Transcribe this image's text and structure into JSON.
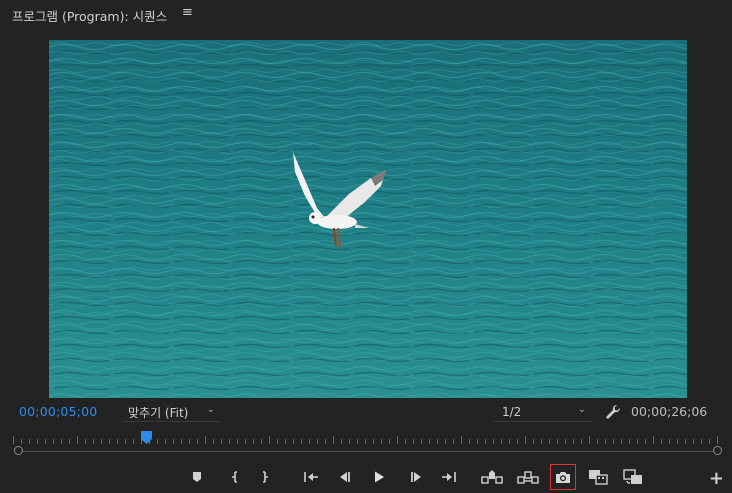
{
  "panel": {
    "title": "프로그램 (Program): 시퀀스",
    "menu_icon": "hamburger-menu-icon"
  },
  "viewer": {
    "content": "video-frame",
    "colors": {
      "water": "#1f7a82",
      "water_dark": "#165f66",
      "water_light": "#3fa1a4"
    }
  },
  "controls": {
    "current_timecode": "00;00;05;00",
    "zoom": {
      "label": "맞추기 (Fit)",
      "icon": "chevron-down-icon"
    },
    "resolution": {
      "label": "1/2",
      "icon": "chevron-down-icon"
    },
    "settings_icon": "wrench-icon",
    "duration_timecode": "00;00;26;06",
    "accent_color": "#2d8ceb"
  },
  "transport": {
    "buttons": [
      {
        "name": "add-marker-button",
        "icon": "marker-icon"
      },
      {
        "name": "mark-in-button",
        "icon": "mark-in-icon"
      },
      {
        "name": "mark-out-button",
        "icon": "mark-out-icon"
      },
      {
        "name": "go-to-in-button",
        "icon": "go-to-in-icon"
      },
      {
        "name": "step-back-button",
        "icon": "step-back-icon"
      },
      {
        "name": "play-button",
        "icon": "play-icon"
      },
      {
        "name": "step-forward-button",
        "icon": "step-forward-icon"
      },
      {
        "name": "go-to-out-button",
        "icon": "go-to-out-icon"
      },
      {
        "name": "lift-button",
        "icon": "lift-icon"
      },
      {
        "name": "extract-button",
        "icon": "extract-icon"
      },
      {
        "name": "export-frame-button",
        "icon": "camera-icon",
        "selected": true
      },
      {
        "name": "comparison-view-button",
        "icon": "comparison-view-icon"
      },
      {
        "name": "toggle-proxies-button",
        "icon": "toggle-proxies-icon"
      }
    ],
    "add_button": {
      "label": "+",
      "icon": "plus-icon"
    },
    "selection_color": "#e0352f"
  }
}
